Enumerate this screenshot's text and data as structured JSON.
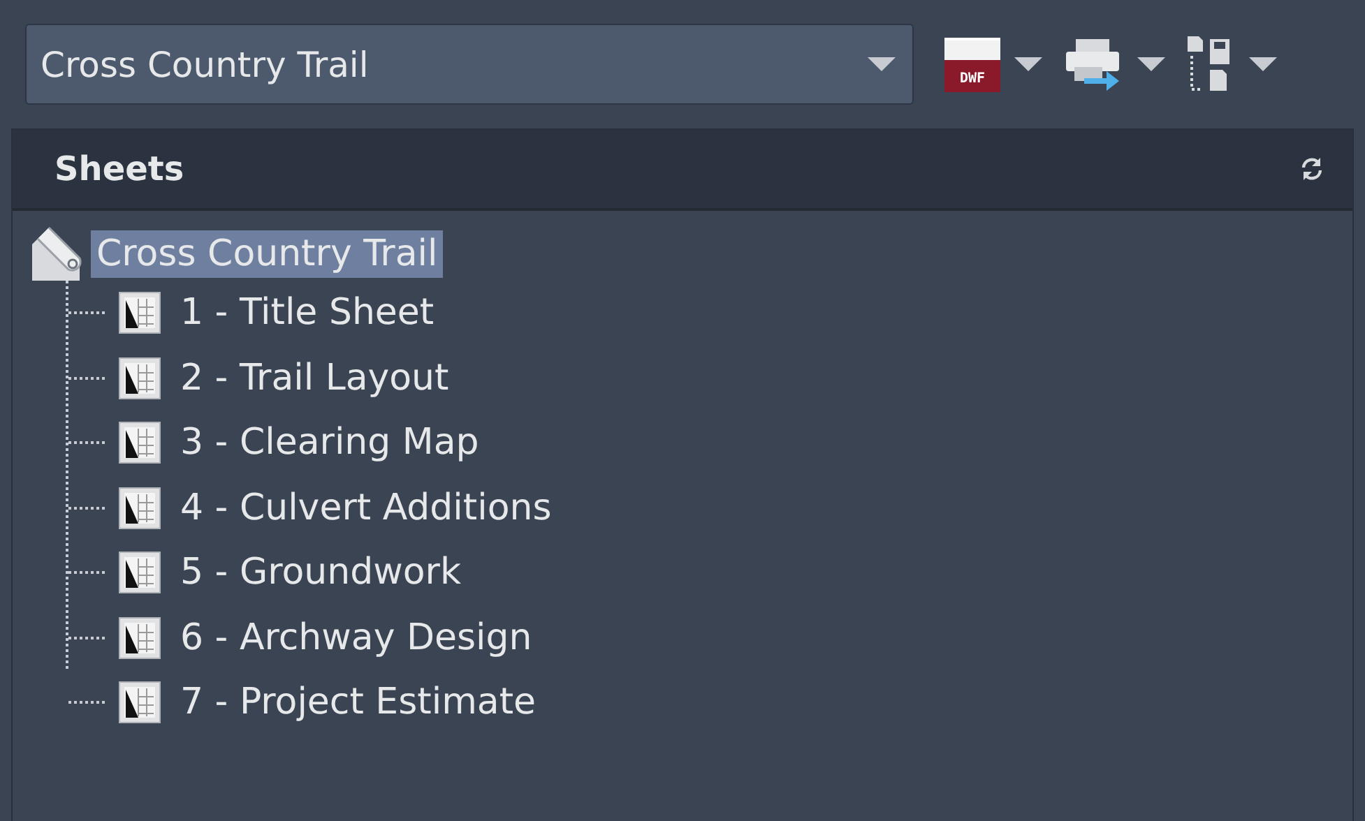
{
  "sheet_set_dropdown": {
    "value": "Cross Country Trail"
  },
  "toolbar": {
    "publish_label": "DWF"
  },
  "panel": {
    "title": "Sheets"
  },
  "tree": {
    "label": "Cross Country Trail",
    "selected": true,
    "expanded": true,
    "children": [
      {
        "label": "1 - Title Sheet",
        "selected": false
      },
      {
        "label": "2 - Trail Layout",
        "selected": false
      },
      {
        "label": "3 - Clearing Map",
        "selected": false
      },
      {
        "label": "4 - Culvert Additions",
        "selected": false
      },
      {
        "label": "5 - Groundwork",
        "selected": false
      },
      {
        "label": "6 - Archway Design",
        "selected": false
      },
      {
        "label": "7 - Project Estimate",
        "selected": false
      }
    ]
  }
}
